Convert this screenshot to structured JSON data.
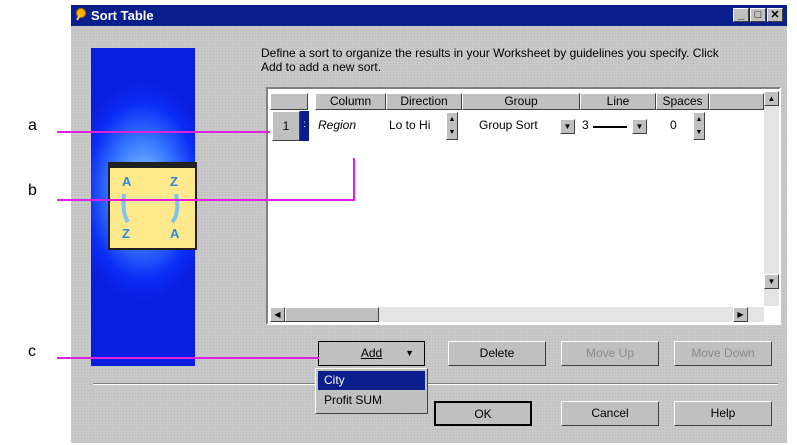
{
  "annotations": {
    "a": "a",
    "b": "b",
    "c": "c"
  },
  "dialog": {
    "title": "Sort Table",
    "title_icon": "pin-icon",
    "window_buttons": [
      "_",
      "□",
      "✕"
    ],
    "description": "Define a sort to organize the results in your Worksheet by guidelines you specify. Click Add to add a new sort.",
    "illustration": {
      "letters": [
        "A",
        "Z",
        "Z",
        "A"
      ]
    }
  },
  "grid": {
    "columns": [
      "Column",
      "Direction",
      "Group",
      "Line",
      "Spaces"
    ],
    "rows": [
      {
        "index": "1",
        "column": "Region",
        "direction": "Lo to Hi",
        "group": "Group Sort",
        "line": "3",
        "spaces": "0"
      }
    ]
  },
  "buttons": {
    "add": "Add",
    "delete": "Delete",
    "move_up": "Move Up",
    "move_down": "Move Down",
    "ok": "OK",
    "cancel": "Cancel",
    "help": "Help"
  },
  "add_menu": {
    "items": [
      "City",
      "Profit SUM"
    ],
    "selected": "City"
  },
  "colors": {
    "accent": "#0a1e8c",
    "annotation_line": "#e020e0",
    "menu_highlight": "#0a1e8c"
  }
}
